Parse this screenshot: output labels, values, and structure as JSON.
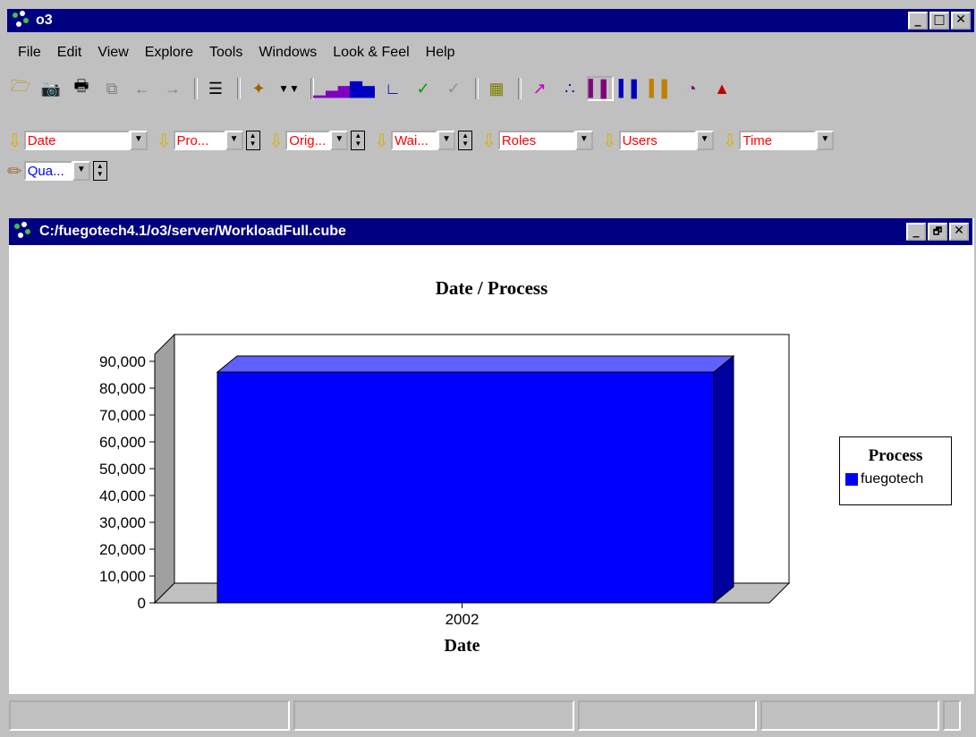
{
  "window": {
    "title": "o3",
    "min": "_",
    "max": "□",
    "close": "✕"
  },
  "menu": [
    "File",
    "Edit",
    "View",
    "Explore",
    "Tools",
    "Windows",
    "Look & Feel",
    "Help"
  ],
  "toolbar": {
    "icons": [
      "open-icon",
      "camera-icon",
      "print-icon",
      "copy-icon",
      "back-arrow-icon",
      "forward-arrow-icon",
      "tree-icon",
      "drill-icon",
      "rows-icon",
      "bar-chart-icon",
      "stacked-bar-icon",
      "axis-icon",
      "check-green-icon",
      "check-gray-icon",
      "table-icon",
      "line-chart-icon",
      "scatter-chart-icon",
      "bar3d-chart-icon",
      "bar3d-stacked-icon",
      "column-chart-icon",
      "pie-chart-icon",
      "pyramid-icon"
    ]
  },
  "dimensions": {
    "row1": [
      {
        "name": "Date",
        "spin": false
      },
      {
        "name": "Pro...",
        "spin": true
      },
      {
        "name": "Orig...",
        "spin": true
      },
      {
        "name": "Wai...",
        "spin": true
      },
      {
        "name": "Roles",
        "spin": false
      },
      {
        "name": "Users",
        "spin": false
      },
      {
        "name": "Time",
        "spin": false
      }
    ],
    "row2": [
      {
        "name": "Qua...",
        "spin": true
      }
    ]
  },
  "child_window": {
    "title": "C:/fuegotech4.1/o3/server/WorkloadFull.cube",
    "min": "_",
    "max": "🗗",
    "close": "✕"
  },
  "chart_data": {
    "type": "bar",
    "title": "Date / Process",
    "xlabel": "Date",
    "ylabel": "",
    "categories": [
      "2002"
    ],
    "series": [
      {
        "name": "fuegotech",
        "values": [
          86000
        ],
        "color": "#0000ff"
      }
    ],
    "ylim": [
      0,
      90000
    ],
    "yticks": [
      "0",
      "10,000",
      "20,000",
      "30,000",
      "40,000",
      "50,000",
      "60,000",
      "70,000",
      "80,000",
      "90,000"
    ],
    "legend": {
      "title": "Process",
      "placement": "right"
    },
    "style": "3d"
  }
}
